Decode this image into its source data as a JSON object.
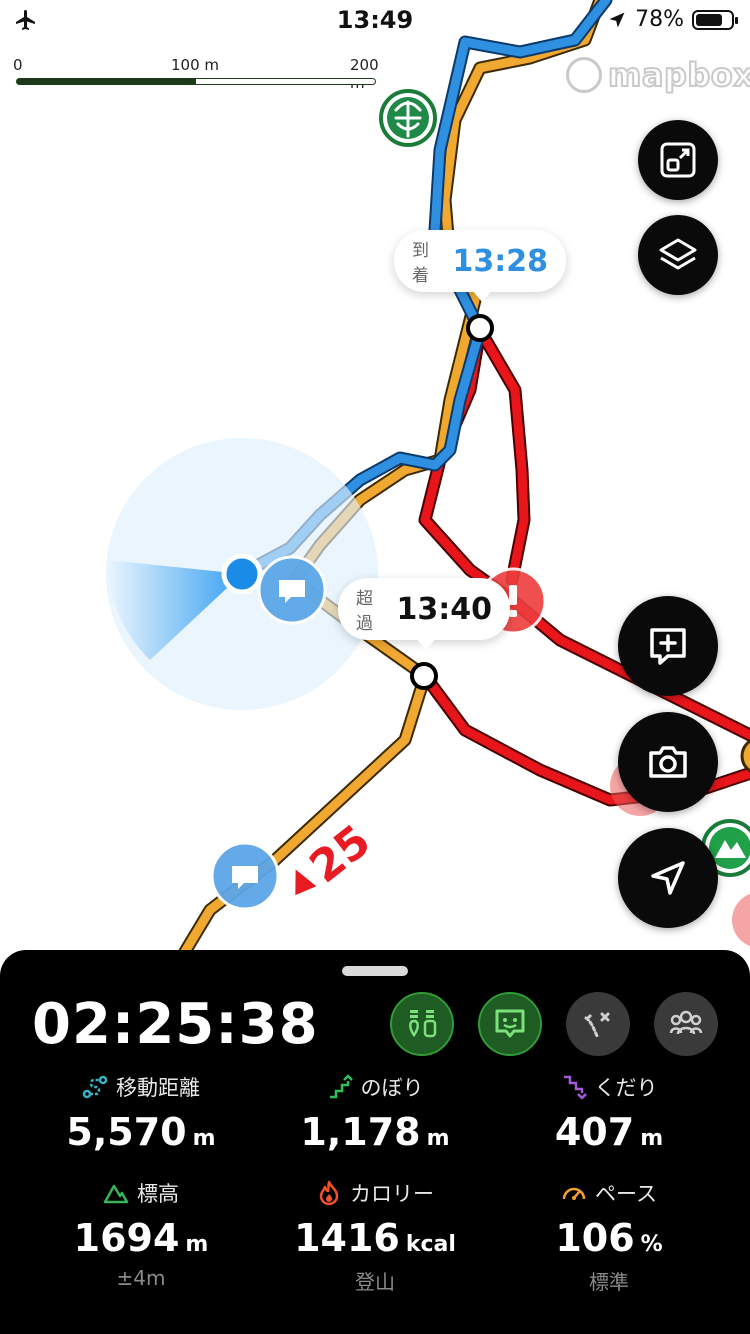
{
  "status_bar": {
    "time": "13:49",
    "battery": "78%",
    "battery_level": 0.78
  },
  "scale_bar": {
    "labels": [
      "0",
      "100 m",
      "200 m"
    ],
    "fill_fraction": 0.5
  },
  "map": {
    "attribution": "mapbox",
    "arrival_bubble": {
      "label": "到着",
      "time": "13:28"
    },
    "over_bubble": {
      "label": "超過",
      "time": "13:40"
    },
    "course_marker": "25",
    "colors": {
      "planned": "#f0a830",
      "recorded": "#2f8fe0",
      "other_route": "#e8151b"
    }
  },
  "icons": {
    "map_type": "map-type-icon",
    "layers": "layers-icon",
    "add_memo": "add-memo-icon",
    "camera": "camera-icon",
    "location": "location-arrow-icon",
    "airplane": "airplane-icon"
  },
  "panel": {
    "elapsed": "02:25:38",
    "stats": [
      {
        "label": "移動距離",
        "value": "5,570",
        "unit": "m",
        "sub": "",
        "color": "#37b3c8"
      },
      {
        "label": "のぼり",
        "value": "1,178",
        "unit": "m",
        "sub": "",
        "color": "#2fbf5a"
      },
      {
        "label": "くだり",
        "value": "407",
        "unit": "m",
        "sub": "",
        "color": "#a35bd8"
      },
      {
        "label": "標高",
        "value": "1694",
        "unit": "m",
        "sub": "±4m",
        "color": "#36b35a"
      },
      {
        "label": "カロリー",
        "value": "1416",
        "unit": "kcal",
        "sub": "登山",
        "color": "#f2512b"
      },
      {
        "label": "ペース",
        "value": "106",
        "unit": "%",
        "sub": "標準",
        "color": "#f2a12b"
      }
    ]
  }
}
